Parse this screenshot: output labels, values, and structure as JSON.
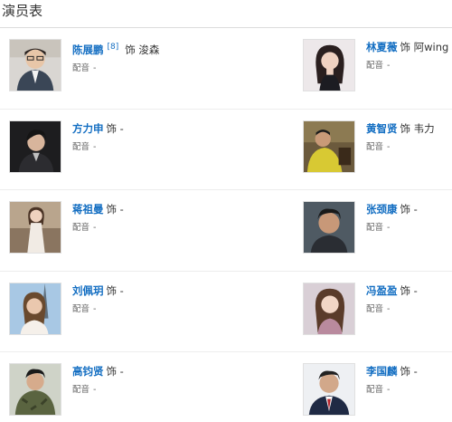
{
  "section": {
    "title": "演员表"
  },
  "labels": {
    "role_prefix": "饰",
    "voice_label": "配音"
  },
  "cast": [
    {
      "name": "陈展鹏",
      "ref": "[8]",
      "role": "浚森",
      "voice": "-"
    },
    {
      "name": "林夏薇",
      "ref": "",
      "role": "阿wing",
      "voice": "-"
    },
    {
      "name": "方力申",
      "ref": "",
      "role": "-",
      "voice": "-"
    },
    {
      "name": "黄智贤",
      "ref": "",
      "role": "韦力",
      "voice": "-"
    },
    {
      "name": "蒋祖曼",
      "ref": "",
      "role": "-",
      "voice": "-"
    },
    {
      "name": "张颈康",
      "ref": "",
      "role": "-",
      "voice": "-"
    },
    {
      "name": "刘佩玥",
      "ref": "",
      "role": "-",
      "voice": "-"
    },
    {
      "name": "冯盈盈",
      "ref": "",
      "role": "-",
      "voice": "-"
    },
    {
      "name": "高钧贤",
      "ref": "",
      "role": "-",
      "voice": "-"
    },
    {
      "name": "李国麟",
      "ref": "",
      "role": "-",
      "voice": "-"
    }
  ]
}
